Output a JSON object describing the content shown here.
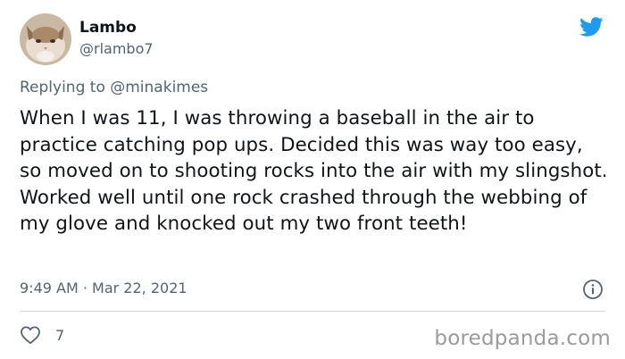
{
  "author": {
    "display_name": "Lambo",
    "handle": "@rlambo7",
    "avatar": "cat-avatar"
  },
  "reply": {
    "prefix": "Replying to",
    "mention": "@minakimes"
  },
  "tweet": {
    "text": "When I was 11, I was throwing a baseball in the air to practice catching pop ups. Decided this was way too easy, so moved on to shooting rocks into the air with my slingshot. Worked well until one rock crashed through the webbing of my glove and knocked out my two front teeth!",
    "timestamp": "9:49 AM · Mar 22, 2021"
  },
  "stats": {
    "likes": "7"
  },
  "icons": {
    "brand": "twitter-bird-icon",
    "info": "info-icon",
    "like": "heart-icon"
  },
  "colors": {
    "twitter_blue": "#1d9bf0",
    "secondary_text": "#536471",
    "divider": "#cfd9de"
  },
  "watermark": "boredpanda.com"
}
